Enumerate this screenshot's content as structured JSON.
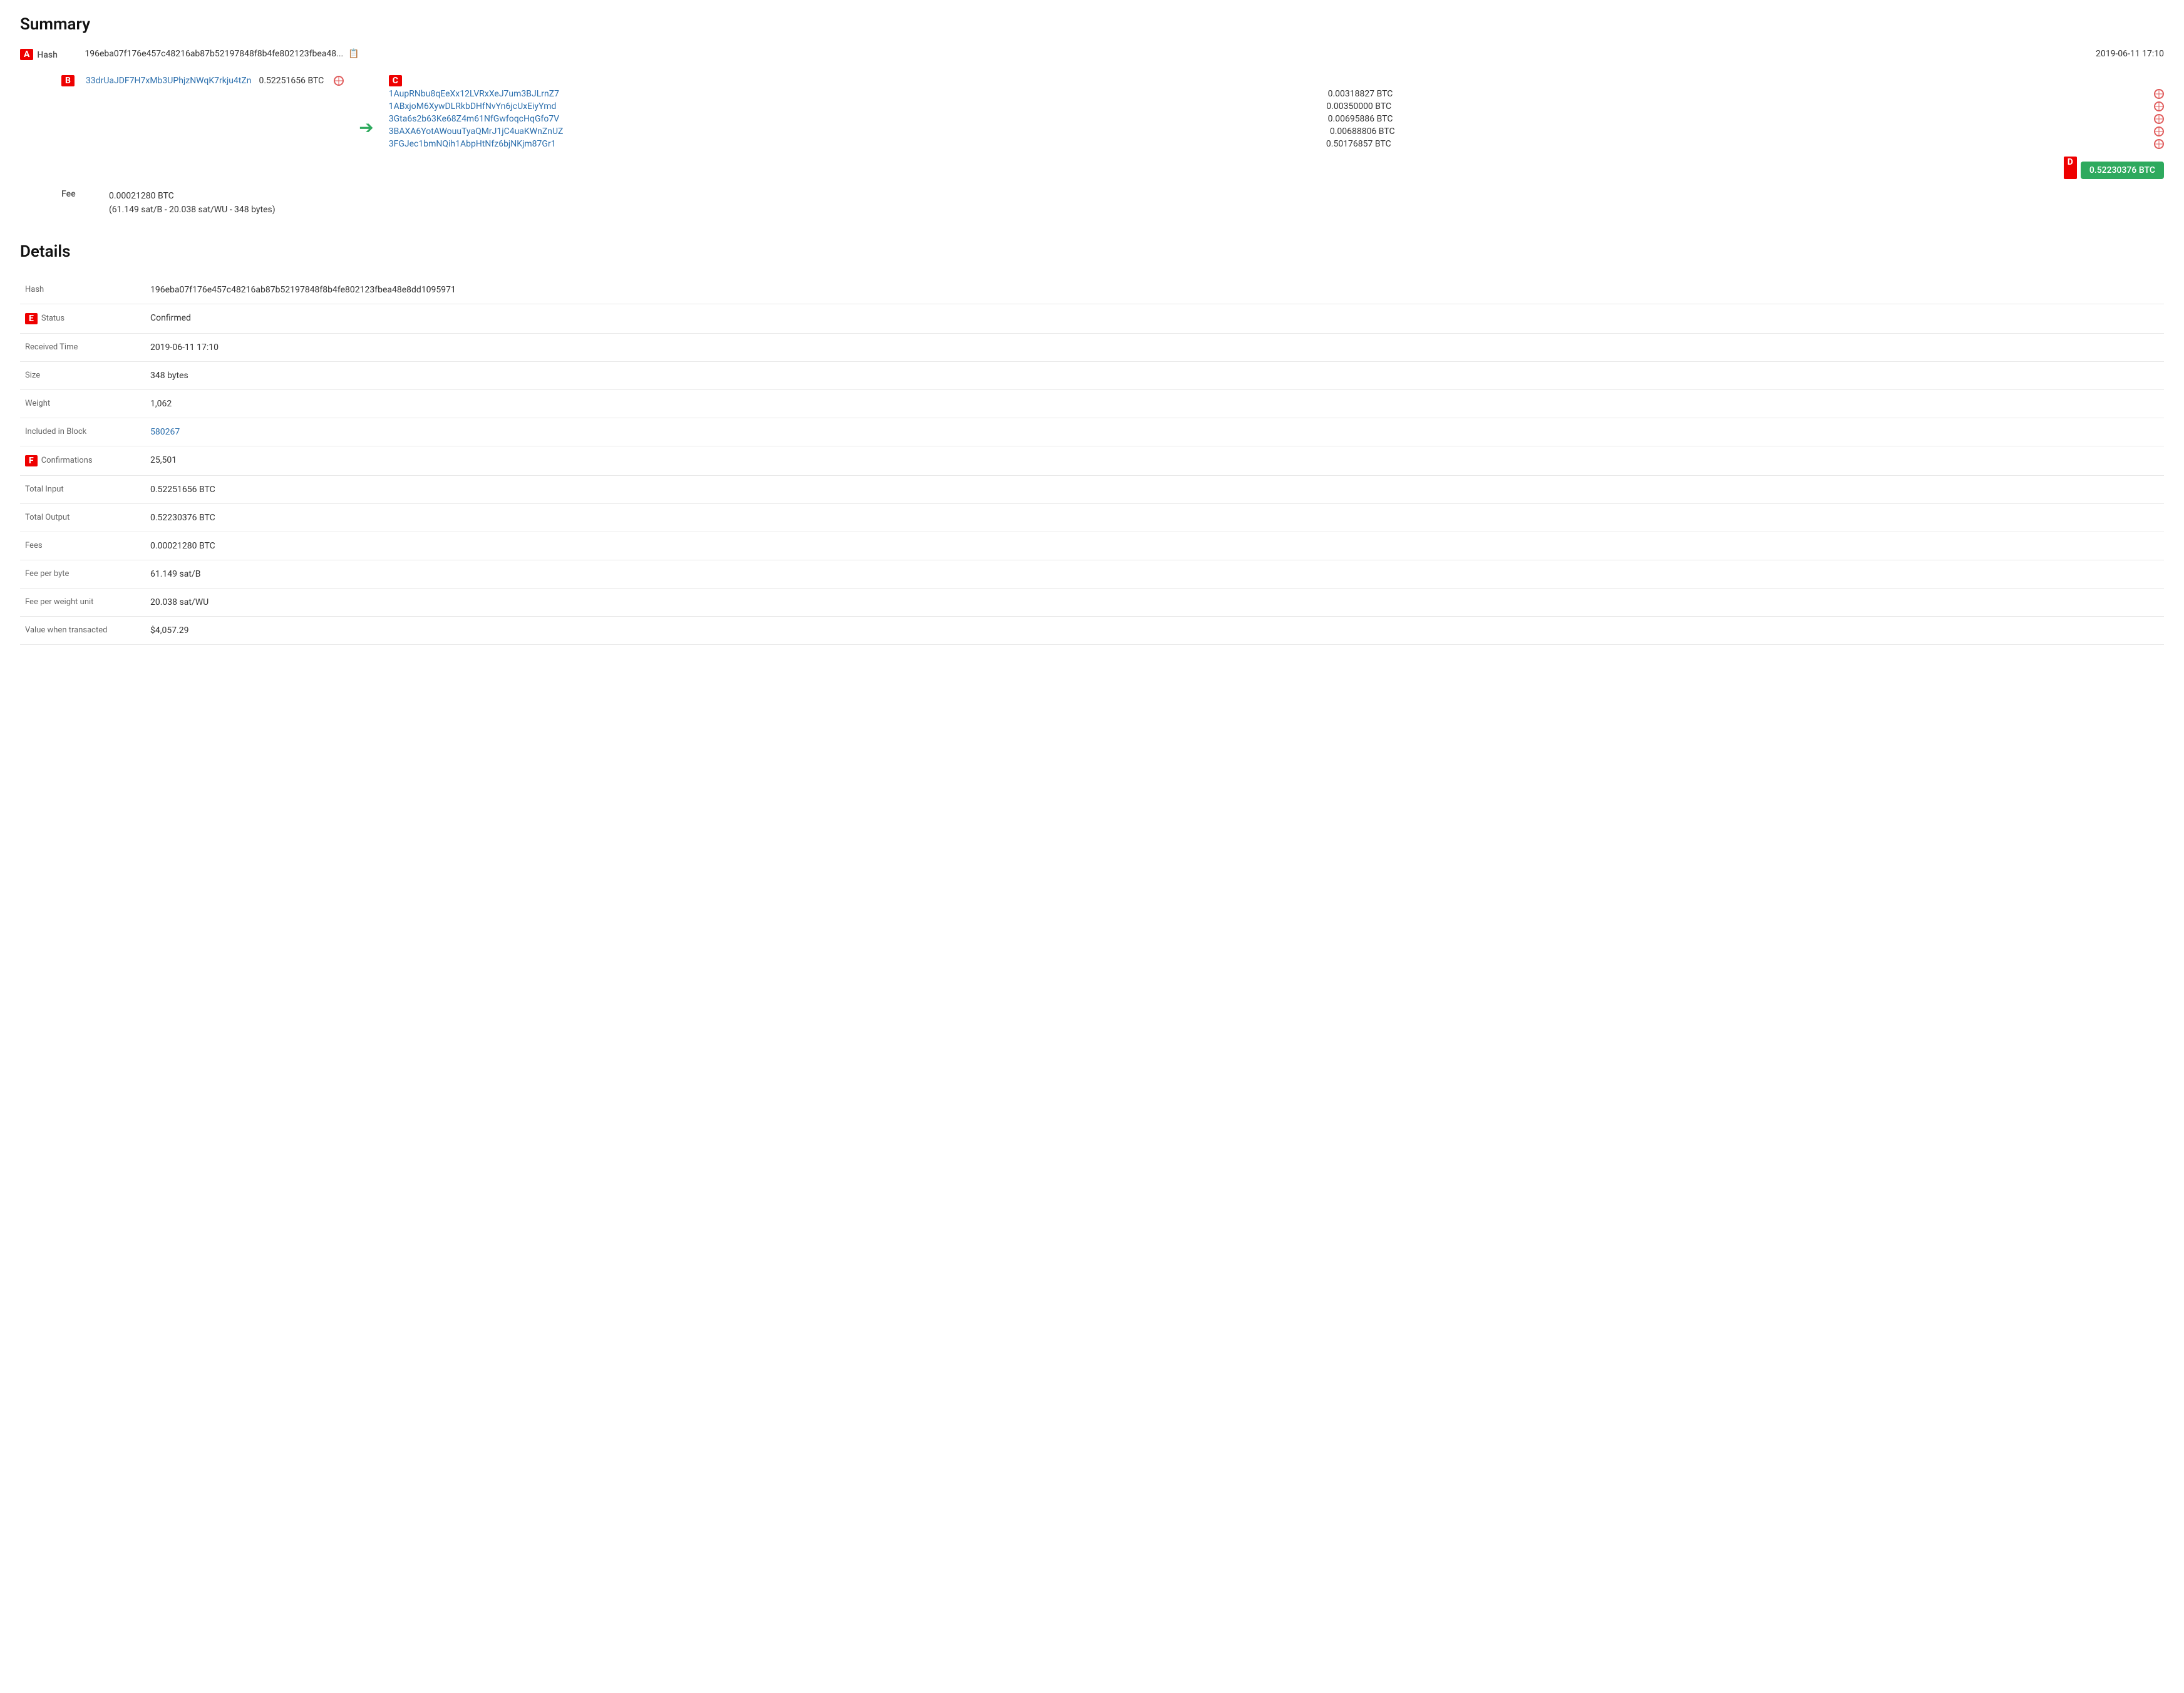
{
  "summary": {
    "title": "Summary",
    "hash_short": "196eba07f176e457c48216ab87b52197848f8b4fe802123fbea48...",
    "hash_full": "196eba07f176e457c48216ab87b52197848f8b4fe802123fbea48e8dd1095971",
    "date": "2019-06-11 17:10",
    "annotation_a": "A",
    "annotation_b": "B",
    "annotation_c": "C",
    "annotation_d": "D",
    "annotation_e": "E",
    "annotation_f": "F",
    "input": {
      "address": "33drUaJDF7H7xMb3UPhjzNWqK7rkju4tZn",
      "amount": "0.52251656 BTC"
    },
    "outputs": [
      {
        "address": "1AupRNbu8qEeXx12LVRxXeJ7um3BJLrnZ7",
        "amount": "0.00318827 BTC"
      },
      {
        "address": "1ABxjoM6XywDLRkbDHfNvYn6jcUxEiyYmd",
        "amount": "0.00350000 BTC"
      },
      {
        "address": "3Gta6s2b63Ke68Z4m61NfGwfoqcHqGfo7V",
        "amount": "0.00695886 BTC"
      },
      {
        "address": "3BAXA6YotAWouuTyaQMrJ1jC4uaKWnZnUZ",
        "amount": "0.00688806 BTC"
      },
      {
        "address": "3FGJec1bmNQih1AbpHtNfz6bjNKjm87Gr1",
        "amount": "0.50176857 BTC"
      }
    ],
    "total_output": "0.52230376 BTC",
    "fee_btc": "0.00021280 BTC",
    "fee_detail": "(61.149 sat/B - 20.038 sat/WU - 348 bytes)"
  },
  "details": {
    "title": "Details",
    "rows": [
      {
        "label": "Hash",
        "value": "196eba07f176e457c48216ab87b52197848f8b4fe802123fbea48e8dd1095971",
        "type": "text"
      },
      {
        "label": "Status",
        "value": "Confirmed",
        "type": "status"
      },
      {
        "label": "Received Time",
        "value": "2019-06-11 17:10",
        "type": "text"
      },
      {
        "label": "Size",
        "value": "348 bytes",
        "type": "text"
      },
      {
        "label": "Weight",
        "value": "1,062",
        "type": "text"
      },
      {
        "label": "Included in Block",
        "value": "580267",
        "type": "link"
      },
      {
        "label": "Confirmations",
        "value": "25,501",
        "type": "text"
      },
      {
        "label": "Total Input",
        "value": "0.52251656 BTC",
        "type": "text"
      },
      {
        "label": "Total Output",
        "value": "0.52230376 BTC",
        "type": "text"
      },
      {
        "label": "Fees",
        "value": "0.00021280 BTC",
        "type": "text"
      },
      {
        "label": "Fee per byte",
        "value": "61.149 sat/B",
        "type": "text"
      },
      {
        "label": "Fee per weight unit",
        "value": "20.038 sat/WU",
        "type": "text"
      },
      {
        "label": "Value when transacted",
        "value": "$4,057.29",
        "type": "text"
      }
    ]
  }
}
